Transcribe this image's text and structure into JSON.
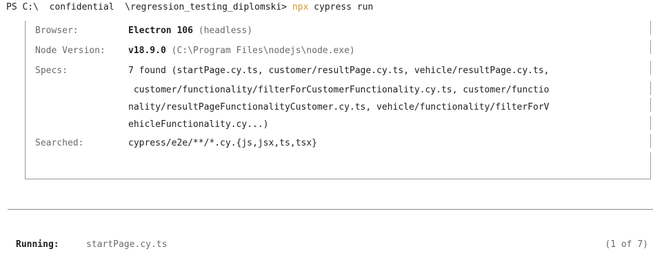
{
  "prompt": {
    "prefix": "PS C:\\  confidential  \\regression_testing_diplomski> ",
    "npx": "npx",
    "rest": " cypress run"
  },
  "info": [
    {
      "label": "Browser:",
      "value": "Electron 106 ",
      "extra": "(headless)"
    },
    {
      "label": "Node Version:",
      "value": "v18.9.0 ",
      "extra": "(C:\\Program Files\\nodejs\\node.exe)"
    },
    {
      "label": "Specs:",
      "lines": [
        "7 found (startPage.cy.ts, customer/resultPage.cy.ts, vehicle/resultPage.cy.ts,",
        " customer/functionality/filterForCustomerFunctionality.cy.ts, customer/functio",
        "nality/resultPageFunctionalityCustomer.cy.ts, vehicle/functionality/filterForV",
        "ehicleFunctionality.cy...)"
      ]
    },
    {
      "label": "Searched:",
      "value": "cypress/e2e/**/*.cy.{js,jsx,ts,tsx}"
    }
  ],
  "running": {
    "label": "Running:",
    "spec": "startPage.cy.ts",
    "count": "(1 of 7)"
  }
}
